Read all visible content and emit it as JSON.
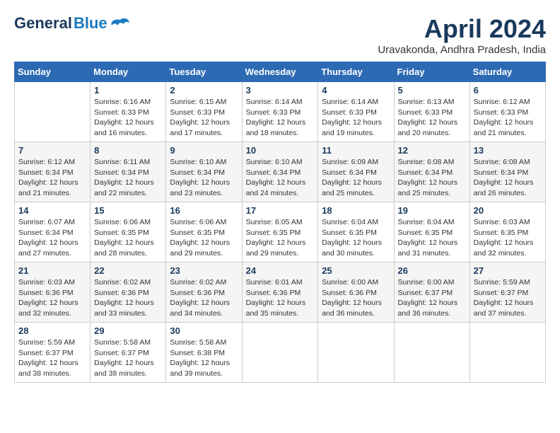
{
  "header": {
    "logo_general": "General",
    "logo_blue": "Blue",
    "month_year": "April 2024",
    "location": "Uravakonda, Andhra Pradesh, India"
  },
  "days_of_week": [
    "Sunday",
    "Monday",
    "Tuesday",
    "Wednesday",
    "Thursday",
    "Friday",
    "Saturday"
  ],
  "weeks": [
    [
      {
        "day": "",
        "info": ""
      },
      {
        "day": "1",
        "info": "Sunrise: 6:16 AM\nSunset: 6:33 PM\nDaylight: 12 hours\nand 16 minutes."
      },
      {
        "day": "2",
        "info": "Sunrise: 6:15 AM\nSunset: 6:33 PM\nDaylight: 12 hours\nand 17 minutes."
      },
      {
        "day": "3",
        "info": "Sunrise: 6:14 AM\nSunset: 6:33 PM\nDaylight: 12 hours\nand 18 minutes."
      },
      {
        "day": "4",
        "info": "Sunrise: 6:14 AM\nSunset: 6:33 PM\nDaylight: 12 hours\nand 19 minutes."
      },
      {
        "day": "5",
        "info": "Sunrise: 6:13 AM\nSunset: 6:33 PM\nDaylight: 12 hours\nand 20 minutes."
      },
      {
        "day": "6",
        "info": "Sunrise: 6:12 AM\nSunset: 6:33 PM\nDaylight: 12 hours\nand 21 minutes."
      }
    ],
    [
      {
        "day": "7",
        "info": "Sunrise: 6:12 AM\nSunset: 6:34 PM\nDaylight: 12 hours\nand 21 minutes."
      },
      {
        "day": "8",
        "info": "Sunrise: 6:11 AM\nSunset: 6:34 PM\nDaylight: 12 hours\nand 22 minutes."
      },
      {
        "day": "9",
        "info": "Sunrise: 6:10 AM\nSunset: 6:34 PM\nDaylight: 12 hours\nand 23 minutes."
      },
      {
        "day": "10",
        "info": "Sunrise: 6:10 AM\nSunset: 6:34 PM\nDaylight: 12 hours\nand 24 minutes."
      },
      {
        "day": "11",
        "info": "Sunrise: 6:09 AM\nSunset: 6:34 PM\nDaylight: 12 hours\nand 25 minutes."
      },
      {
        "day": "12",
        "info": "Sunrise: 6:08 AM\nSunset: 6:34 PM\nDaylight: 12 hours\nand 25 minutes."
      },
      {
        "day": "13",
        "info": "Sunrise: 6:08 AM\nSunset: 6:34 PM\nDaylight: 12 hours\nand 26 minutes."
      }
    ],
    [
      {
        "day": "14",
        "info": "Sunrise: 6:07 AM\nSunset: 6:34 PM\nDaylight: 12 hours\nand 27 minutes."
      },
      {
        "day": "15",
        "info": "Sunrise: 6:06 AM\nSunset: 6:35 PM\nDaylight: 12 hours\nand 28 minutes."
      },
      {
        "day": "16",
        "info": "Sunrise: 6:06 AM\nSunset: 6:35 PM\nDaylight: 12 hours\nand 29 minutes."
      },
      {
        "day": "17",
        "info": "Sunrise: 6:05 AM\nSunset: 6:35 PM\nDaylight: 12 hours\nand 29 minutes."
      },
      {
        "day": "18",
        "info": "Sunrise: 6:04 AM\nSunset: 6:35 PM\nDaylight: 12 hours\nand 30 minutes."
      },
      {
        "day": "19",
        "info": "Sunrise: 6:04 AM\nSunset: 6:35 PM\nDaylight: 12 hours\nand 31 minutes."
      },
      {
        "day": "20",
        "info": "Sunrise: 6:03 AM\nSunset: 6:35 PM\nDaylight: 12 hours\nand 32 minutes."
      }
    ],
    [
      {
        "day": "21",
        "info": "Sunrise: 6:03 AM\nSunset: 6:36 PM\nDaylight: 12 hours\nand 32 minutes."
      },
      {
        "day": "22",
        "info": "Sunrise: 6:02 AM\nSunset: 6:36 PM\nDaylight: 12 hours\nand 33 minutes."
      },
      {
        "day": "23",
        "info": "Sunrise: 6:02 AM\nSunset: 6:36 PM\nDaylight: 12 hours\nand 34 minutes."
      },
      {
        "day": "24",
        "info": "Sunrise: 6:01 AM\nSunset: 6:36 PM\nDaylight: 12 hours\nand 35 minutes."
      },
      {
        "day": "25",
        "info": "Sunrise: 6:00 AM\nSunset: 6:36 PM\nDaylight: 12 hours\nand 36 minutes."
      },
      {
        "day": "26",
        "info": "Sunrise: 6:00 AM\nSunset: 6:37 PM\nDaylight: 12 hours\nand 36 minutes."
      },
      {
        "day": "27",
        "info": "Sunrise: 5:59 AM\nSunset: 6:37 PM\nDaylight: 12 hours\nand 37 minutes."
      }
    ],
    [
      {
        "day": "28",
        "info": "Sunrise: 5:59 AM\nSunset: 6:37 PM\nDaylight: 12 hours\nand 38 minutes."
      },
      {
        "day": "29",
        "info": "Sunrise: 5:58 AM\nSunset: 6:37 PM\nDaylight: 12 hours\nand 38 minutes."
      },
      {
        "day": "30",
        "info": "Sunrise: 5:58 AM\nSunset: 6:38 PM\nDaylight: 12 hours\nand 39 minutes."
      },
      {
        "day": "",
        "info": ""
      },
      {
        "day": "",
        "info": ""
      },
      {
        "day": "",
        "info": ""
      },
      {
        "day": "",
        "info": ""
      }
    ]
  ]
}
